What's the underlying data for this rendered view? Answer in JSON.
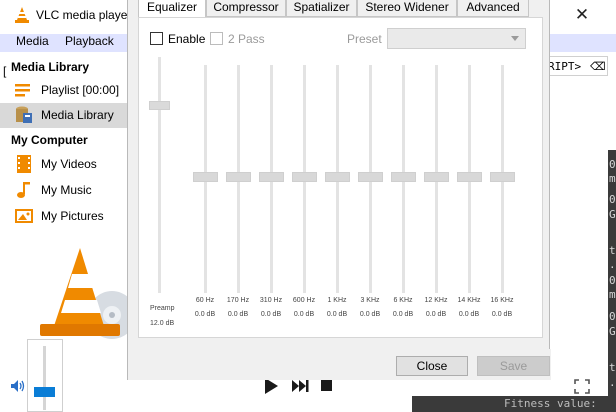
{
  "window": {
    "title": "VLC media player"
  },
  "menu": {
    "media": "Media",
    "playback": "Playback"
  },
  "sidebar": {
    "media_library_header": "Media Library",
    "my_computer_header": "My Computer",
    "items": [
      {
        "label": "Playlist [00:00]",
        "icon": "playlist-icon"
      },
      {
        "label": "Media Library",
        "icon": "media-library-icon",
        "selected": true
      },
      {
        "label": "My Videos",
        "icon": "film-icon"
      },
      {
        "label": "My Music",
        "icon": "music-note-icon"
      },
      {
        "label": "My Pictures",
        "icon": "picture-icon"
      }
    ]
  },
  "background": {
    "script_field": "RIPT>",
    "script_clear": "⌫",
    "bracket": "[",
    "console_lines": [
      "0",
      "m",
      "0",
      "G",
      "t",
      ".",
      "0",
      "m",
      "0",
      "G",
      "t",
      "."
    ],
    "console_bottom": "Fitness value:"
  },
  "volume_level": 0.3,
  "dialog": {
    "tabs": [
      {
        "label": "Equalizer",
        "active": true
      },
      {
        "label": "Compressor",
        "active": false
      },
      {
        "label": "Spatializer",
        "active": false
      },
      {
        "label": "Stereo Widener",
        "active": false
      },
      {
        "label": "Advanced",
        "active": false
      }
    ],
    "enable_label": "Enable",
    "enable_checked": false,
    "two_pass_label": "2 Pass",
    "preset_label": "Preset",
    "preset_value": "",
    "preamp": {
      "label": "Preamp",
      "value": "12.0 dB"
    },
    "bands": [
      {
        "freq": "60 Hz",
        "value": "0.0 dB"
      },
      {
        "freq": "170 Hz",
        "value": "0.0 dB"
      },
      {
        "freq": "310 Hz",
        "value": "0.0 dB"
      },
      {
        "freq": "600 Hz",
        "value": "0.0 dB"
      },
      {
        "freq": "1 KHz",
        "value": "0.0 dB"
      },
      {
        "freq": "3 KHz",
        "value": "0.0 dB"
      },
      {
        "freq": "6 KHz",
        "value": "0.0 dB"
      },
      {
        "freq": "12 KHz",
        "value": "0.0 dB"
      },
      {
        "freq": "14 KHz",
        "value": "0.0 dB"
      },
      {
        "freq": "16 KHz",
        "value": "0.0 dB"
      }
    ],
    "close_label": "Close",
    "save_label": "Save"
  },
  "colors": {
    "accent": "#0a7dd6",
    "cone_orange": "#f08a00",
    "selected_bg": "#d9d9d9",
    "console_bg": "#3a3a3a"
  }
}
